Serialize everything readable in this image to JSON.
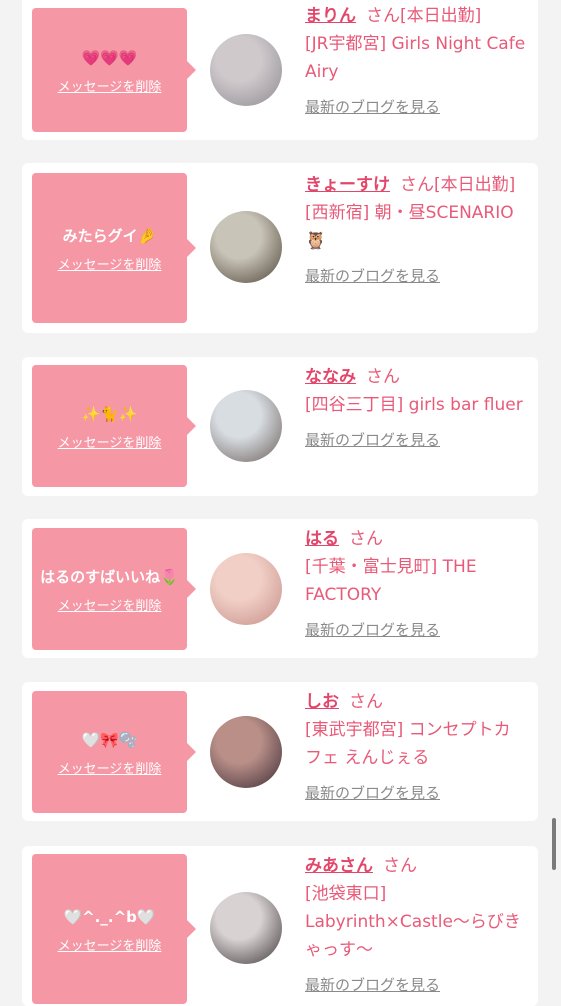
{
  "cards": [
    {
      "message": "💗💗💗",
      "delete_label": "メッセージを削除",
      "name": "まりん",
      "honorific": "さん",
      "status": "[本日出勤]",
      "shop": "[JR宇都宮] Girls Night Cafe Airy",
      "blog_label": "最新のブログを見る",
      "avatar_colors": [
        "#cfc9cc",
        "#8e8a90"
      ]
    },
    {
      "message": "みたらグイ🤌",
      "delete_label": "メッセージを削除",
      "name": "きょーすけ",
      "honorific": "さん",
      "status": "[本日出勤]",
      "shop": "[西新宿] 朝・昼SCENARIO🦉",
      "blog_label": "最新のブログを見る",
      "avatar_colors": [
        "#c9c4b8",
        "#4c4436"
      ]
    },
    {
      "message": "✨🐈✨",
      "delete_label": "メッセージを削除",
      "name": "ななみ",
      "honorific": "さん",
      "status": "",
      "shop": "[四谷三丁目] girls bar fluer",
      "blog_label": "最新のブログを見る",
      "avatar_colors": [
        "#d8dde2",
        "#6b5e59"
      ]
    },
    {
      "message": "はるのすばいいね🌷",
      "delete_label": "メッセージを削除",
      "name": "はる",
      "honorific": "さん",
      "status": "",
      "shop": "[千葉・富士見町] THE FACTORY",
      "blog_label": "最新のブログを見る",
      "avatar_colors": [
        "#f1cfc6",
        "#c48e86"
      ]
    },
    {
      "message": "🤍🎀🫧",
      "delete_label": "メッセージを削除",
      "name": "しお",
      "honorific": "さん",
      "status": "",
      "shop": "[東武宇都宮] コンセプトカフェ えんじぇる",
      "blog_label": "最新のブログを見る",
      "avatar_colors": [
        "#b98f88",
        "#3b2b34"
      ]
    },
    {
      "message": "🤍^._.^b🤍",
      "delete_label": "メッセージを削除",
      "name": "みあさん",
      "honorific": "さん",
      "status": "",
      "shop": "[池袋東口] Labyrinth×Castle〜らびきゃっす〜",
      "blog_label": "最新のブログを見る",
      "avatar_colors": [
        "#d8d2d2",
        "#3d3538"
      ]
    }
  ],
  "colors": {
    "bubble": "#f597a5",
    "name": "#e2476b",
    "accent_text": "#e85a78",
    "blog_link": "#8a8a8a",
    "background": "#f3f3f3"
  }
}
